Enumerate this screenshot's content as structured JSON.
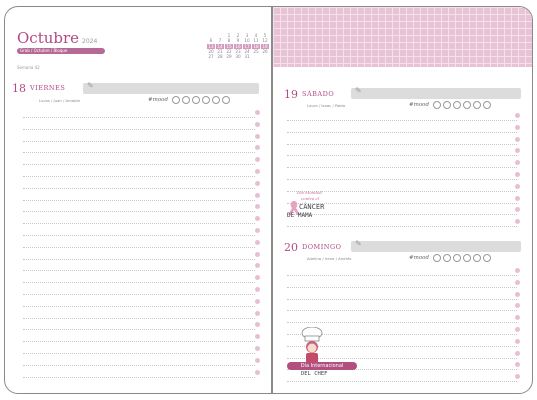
{
  "left_page": {
    "month": "Octubre",
    "year": "2024",
    "tag_bar": "Grab / Octubre / Bloque",
    "week_note": "Semana 42",
    "mini_calendar": [
      [
        "",
        "",
        "1",
        "2",
        "3",
        "4",
        "5"
      ],
      [
        "6",
        "7",
        "8",
        "9",
        "10",
        "11",
        "12"
      ],
      [
        "13",
        "14",
        "15",
        "16",
        "17",
        "18",
        "19"
      ],
      [
        "20",
        "21",
        "22",
        "23",
        "24",
        "25",
        "26"
      ],
      [
        "27",
        "28",
        "29",
        "30",
        "31",
        "",
        ""
      ]
    ],
    "day": {
      "number": "18",
      "name": "VIERNES",
      "saints": "Lucas / Juan / Amable",
      "mood_label": "#mood"
    }
  },
  "right_page": {
    "day1": {
      "number": "19",
      "name": "SÁBADO",
      "saints": "Laura / Isaac / Pablo",
      "mood_label": "#mood"
    },
    "day2": {
      "number": "20",
      "name": "DOMINGO",
      "saints": "Adelina / Irene / Andrés",
      "mood_label": "#mood"
    },
    "sticker_cancer": {
      "line1": "Día Mundial",
      "line2": "contra el",
      "line3": "CÁNCER",
      "line4": "DE MAMA"
    },
    "sticker_chef": {
      "banner": "Día Internacional",
      "text": "DEL CHEF"
    }
  }
}
